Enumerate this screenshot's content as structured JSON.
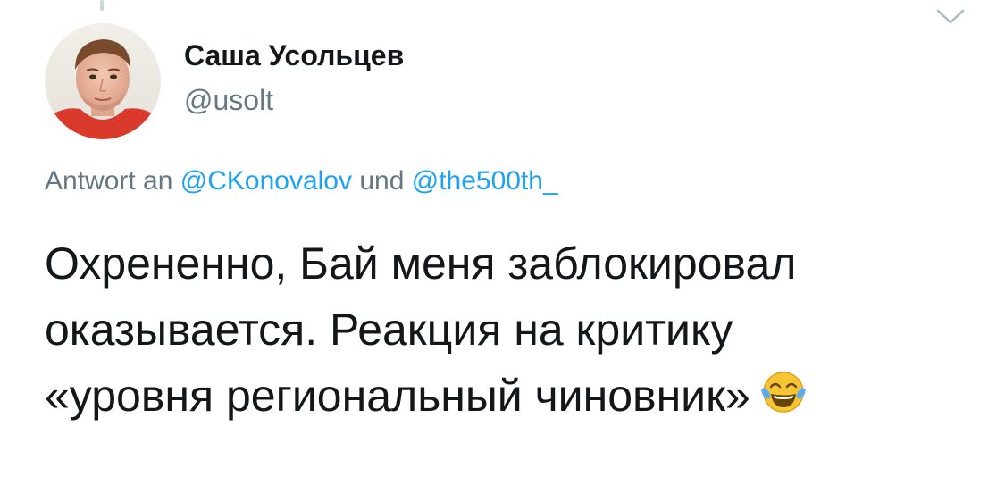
{
  "author": {
    "name": "Саша Усольцев",
    "handle": "@usolt"
  },
  "reply": {
    "prefix": "Antwort an",
    "mention1": "@CKonovalov",
    "conjunction": "und",
    "mention2": "@the500th_"
  },
  "tweet": {
    "line1": "Охрененно, Бай меня заблокировал",
    "line2": "оказывается. Реакция на критику",
    "line3": "«уровня региональный чиновник»",
    "emoji": "face-with-tears-of-joy"
  },
  "icons": {
    "more": "chevron-down-icon"
  },
  "colors": {
    "link": "#1da1f2",
    "secondary_text": "#657786",
    "primary_text": "#14171a",
    "thread_line": "#ccd6dd"
  }
}
